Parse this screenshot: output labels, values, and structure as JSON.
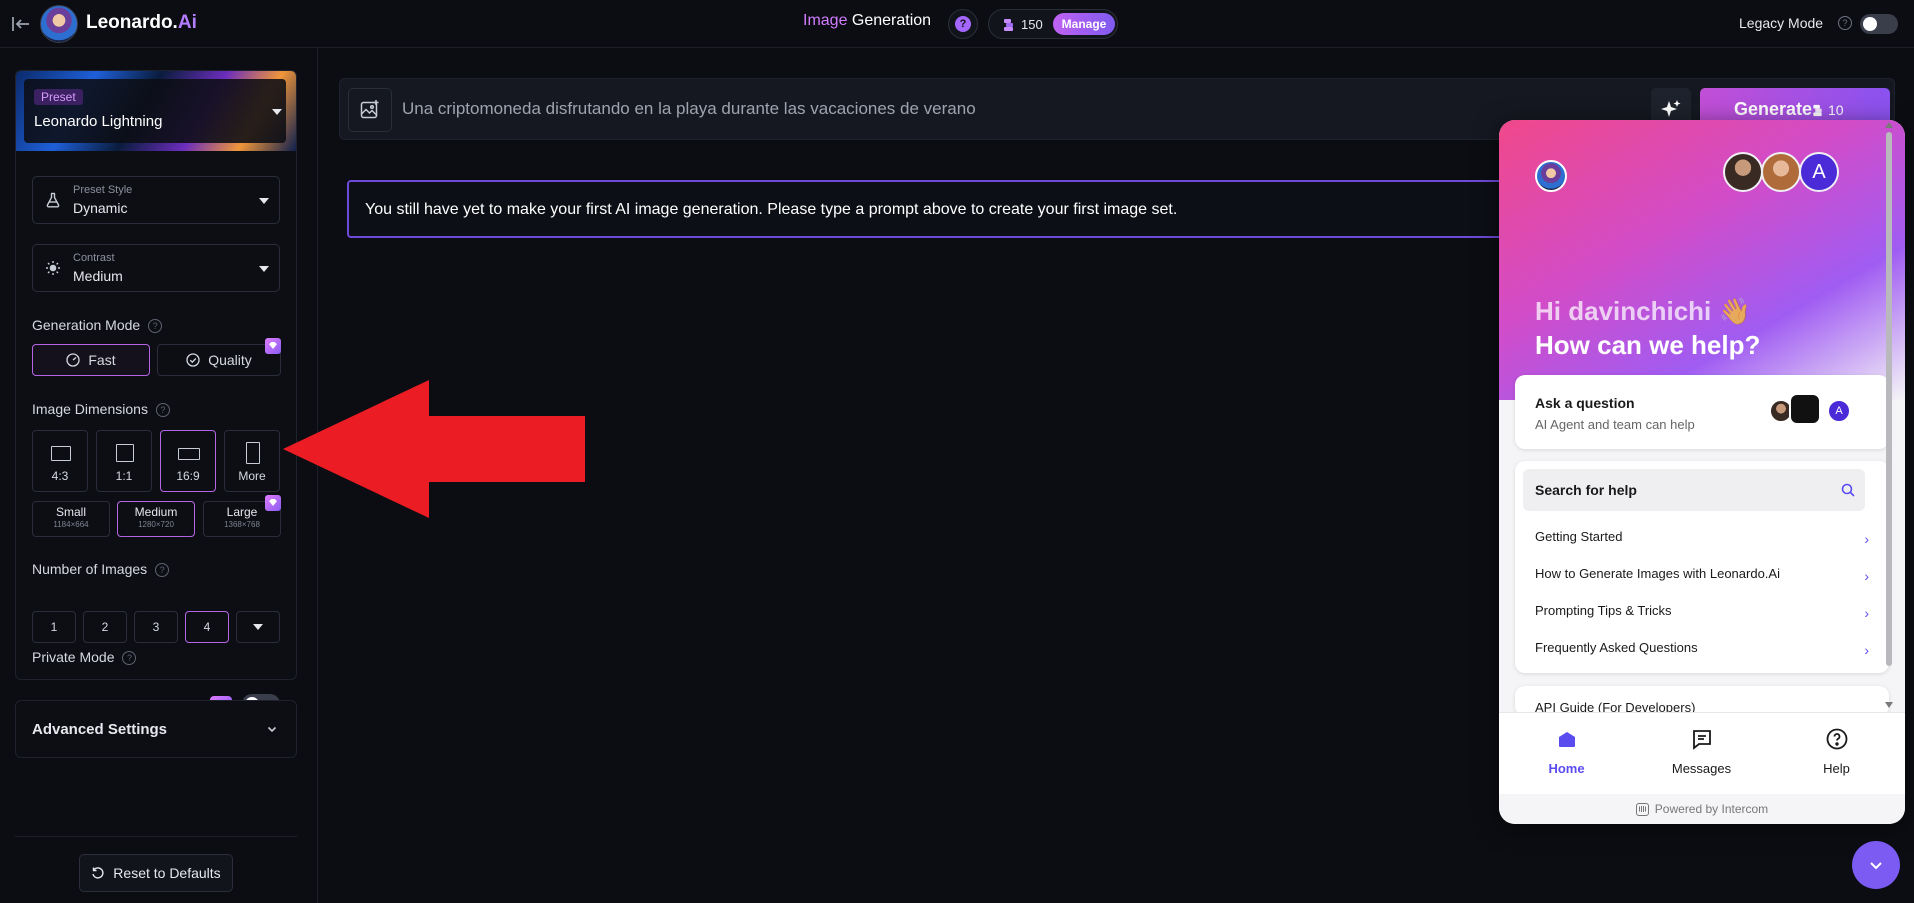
{
  "topbar": {
    "brand_main": "Leonardo.",
    "brand_suffix": "Ai",
    "title_highlight": "Image",
    "title_rest": " Generation",
    "help_glyph": "?",
    "tokens": "150",
    "manage_label": "Manage",
    "legacy_label": "Legacy Mode",
    "legacy_on": false
  },
  "sidebar": {
    "preset_tag": "Preset",
    "preset_name": "Leonardo Lightning",
    "preset_style_label": "Preset Style",
    "preset_style_value": "Dynamic",
    "contrast_label": "Contrast",
    "contrast_value": "Medium",
    "generation_mode_label": "Generation Mode",
    "modes": [
      "Fast",
      "Quality"
    ],
    "active_mode": "Fast",
    "image_dimensions_label": "Image Dimensions",
    "aspect_ratios": [
      "4:3",
      "1:1",
      "16:9",
      "More"
    ],
    "active_ratio": "16:9",
    "sizes": [
      {
        "name": "Small",
        "px": "1184×664"
      },
      {
        "name": "Medium",
        "px": "1280×720"
      },
      {
        "name": "Large",
        "px": "1368×768"
      }
    ],
    "active_size": "Medium",
    "number_of_images_label": "Number of Images",
    "image_counts": [
      "1",
      "2",
      "3",
      "4"
    ],
    "active_count": "4",
    "private_mode_label": "Private Mode",
    "private_on": false,
    "advanced_label": "Advanced Settings",
    "reset_label": "Reset to Defaults"
  },
  "main": {
    "prompt_text": "Una criptomoneda disfrutando en la playa durante las vacaciones de verano",
    "generate_label": "Generate",
    "generate_cost": "10",
    "notice": "You still have yet to make your first AI image generation. Please type a prompt above to create your first image set."
  },
  "intercom": {
    "greeting": "Hi davinchichi 👋",
    "headline": "How can we help?",
    "agent_initial": "A",
    "ask_title": "Ask a question",
    "ask_sub": "AI Agent and team can help",
    "search_label": "Search for help",
    "links": [
      "Getting Started",
      "How to Generate Images with Leonardo.Ai",
      "Prompting Tips & Tricks",
      "Frequently Asked Questions"
    ],
    "api_label": "API Guide (For Developers)",
    "tabs": [
      "Home",
      "Messages",
      "Help"
    ],
    "active_tab": "Home",
    "powered": "Powered by Intercom"
  },
  "colors": {
    "accent": "#b365e6",
    "generate_gradient_start": "#c24fd6",
    "generate_gradient_end": "#8a52ef",
    "annotation_arrow": "#ec1c24",
    "intercom_accent": "#5b4cf0"
  },
  "icons": {
    "back": "arrow-left-bar-icon",
    "flask": "flask-icon",
    "sun": "sun-icon",
    "speedometer": "speedometer-icon",
    "check_circle": "check-circle-icon",
    "gem": "gem-icon",
    "image_add": "image-add-icon",
    "sparkle": "sparkle-icon",
    "coin_stack": "coin-stack-icon",
    "reset": "rotate-ccw-icon",
    "search": "search-icon",
    "chevron_right": "chevron-right-icon",
    "external_link": "external-link-icon",
    "home": "home-icon",
    "messages": "messages-icon",
    "help": "help-circle-icon",
    "chevron_down": "chevron-down-icon"
  }
}
